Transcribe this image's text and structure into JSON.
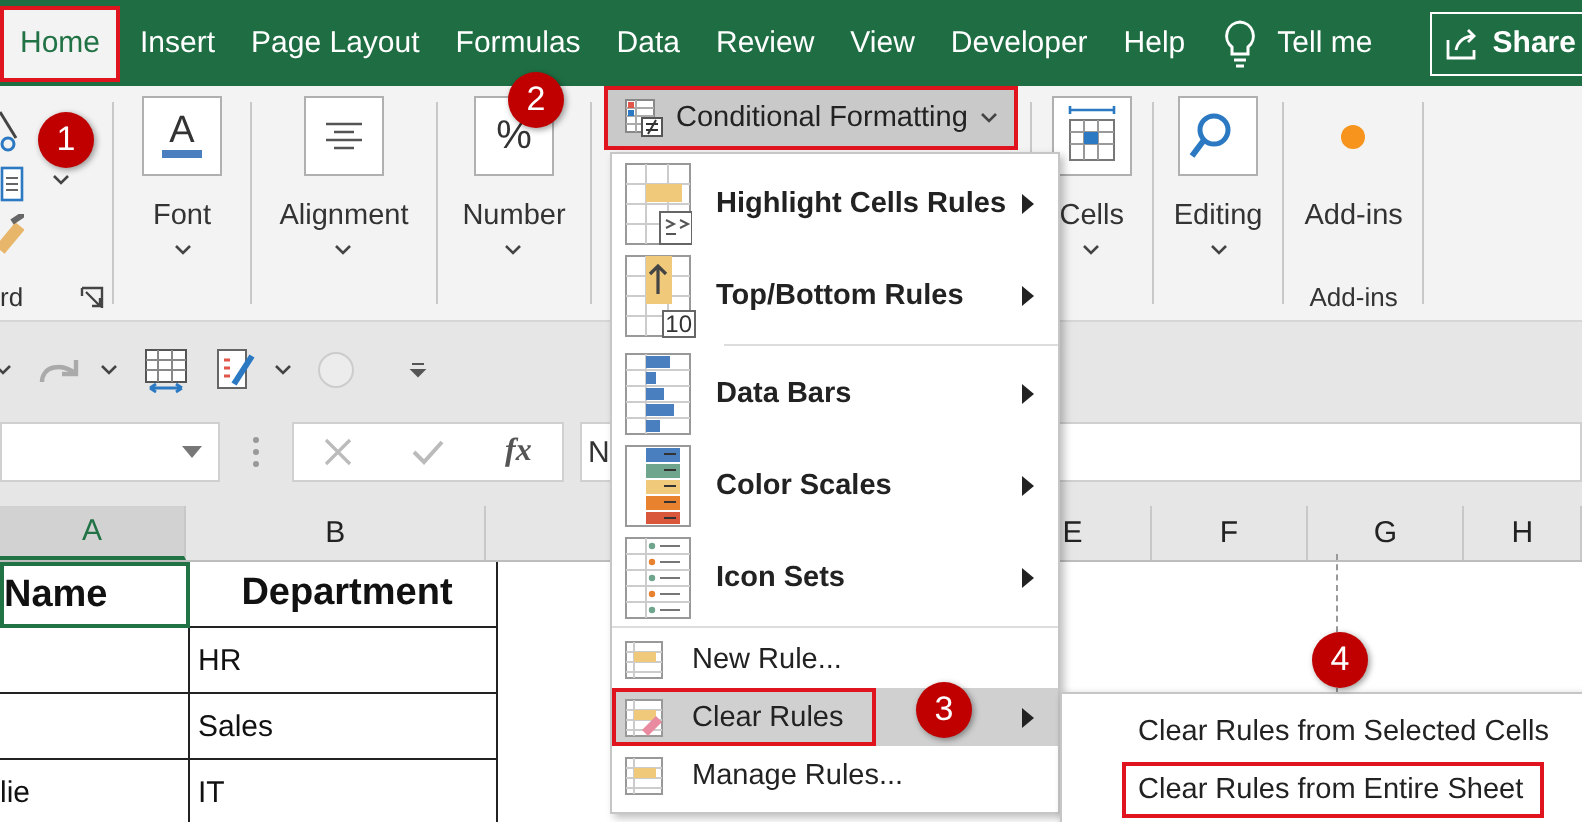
{
  "tabs": [
    {
      "label": "Home",
      "selected": true,
      "outlined": true
    },
    {
      "label": "Insert",
      "selected": false,
      "outlined": false
    },
    {
      "label": "Page Layout",
      "selected": false,
      "outlined": false
    },
    {
      "label": "Formulas",
      "selected": false,
      "outlined": false
    },
    {
      "label": "Data",
      "selected": false,
      "outlined": false
    },
    {
      "label": "Review",
      "selected": false,
      "outlined": false
    },
    {
      "label": "View",
      "selected": false,
      "outlined": false
    },
    {
      "label": "Developer",
      "selected": false,
      "outlined": false
    },
    {
      "label": "Help",
      "selected": false,
      "outlined": false
    }
  ],
  "tell_me": {
    "label": "Tell me"
  },
  "share": {
    "label": "Share"
  },
  "ribbon": {
    "clipboard_label": "rd",
    "groups_left": [
      {
        "label": "Font",
        "glyph": "A"
      },
      {
        "label": "Alignment"
      },
      {
        "label": "Number",
        "glyph": "%"
      }
    ],
    "conditional_formatting": {
      "label": "Conditional Formatting",
      "outlined": true
    },
    "groups_right": [
      {
        "label": "Cells"
      },
      {
        "label": "Editing"
      },
      {
        "label": "Add-ins",
        "group_label": "Add-ins"
      }
    ]
  },
  "formula_bar": {
    "function_label": "fx",
    "value": "N"
  },
  "columns": [
    {
      "label": "A",
      "selected": true
    },
    {
      "label": "B",
      "selected": false
    },
    {
      "label": "E",
      "selected": false
    },
    {
      "label": "F",
      "selected": false
    },
    {
      "label": "G",
      "selected": false
    },
    {
      "label": "H",
      "selected": false
    }
  ],
  "rows": [
    {
      "kind": "header",
      "cells": [
        {
          "text": "Name",
          "selected": true
        },
        {
          "text": "Department",
          "selected": false
        }
      ]
    },
    {
      "kind": "data",
      "cells": [
        {
          "text": "HR",
          "selected": false
        }
      ]
    },
    {
      "kind": "data",
      "cells": [
        {
          "text": "Sales",
          "selected": false
        }
      ]
    },
    {
      "kind": "data",
      "cells": [
        {
          "text": "lie",
          "selected": false
        },
        {
          "text": "IT",
          "selected": false
        }
      ]
    }
  ],
  "menu": {
    "items": [
      {
        "kind": "big",
        "label": "Highlight Cells Rules",
        "selected": false,
        "outlined": false
      },
      {
        "kind": "big",
        "label": "Top/Bottom Rules",
        "icon_text": "10",
        "selected": false,
        "outlined": false
      },
      {
        "kind": "big",
        "label": "Data Bars",
        "selected": false,
        "outlined": false
      },
      {
        "kind": "big",
        "label": "Color Scales",
        "selected": false,
        "outlined": false
      },
      {
        "kind": "big",
        "label": "Icon Sets",
        "selected": false,
        "outlined": false
      },
      {
        "kind": "small",
        "label": "New Rule...",
        "selected": false,
        "outlined": false
      },
      {
        "kind": "submenu",
        "label": "Clear Rules",
        "selected": true,
        "outlined": true
      },
      {
        "kind": "small",
        "label": "Manage Rules...",
        "selected": false,
        "outlined": false
      }
    ]
  },
  "submenu": {
    "items": [
      {
        "label": "Clear Rules from Selected Cells",
        "outlined": false
      },
      {
        "label": "Clear Rules from Entire Sheet",
        "outlined": true
      }
    ]
  },
  "callouts": [
    "1",
    "2",
    "3",
    "4"
  ]
}
